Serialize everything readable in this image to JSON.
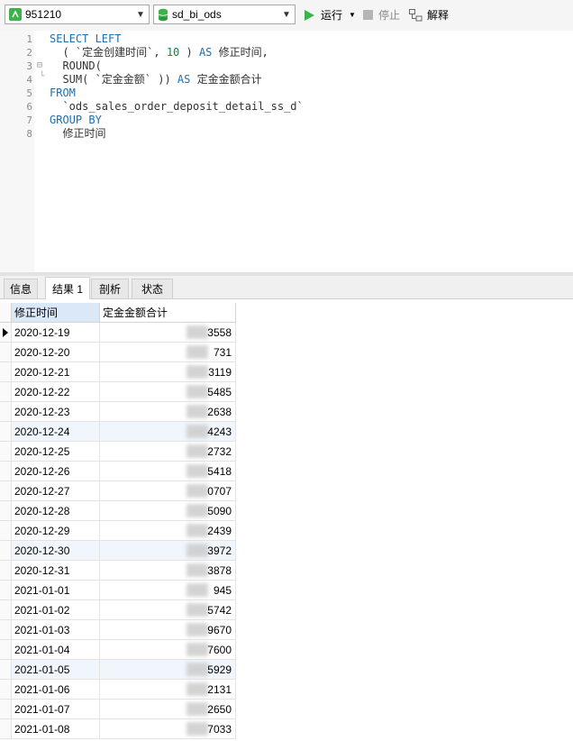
{
  "toolbar": {
    "connection": "951210",
    "database": "sd_bi_ods",
    "run_label": "运行",
    "stop_label": "停止",
    "explain_label": "解释"
  },
  "editor": {
    "line_numbers": [
      "1",
      "2",
      "3",
      "4",
      "5",
      "6",
      "7",
      "8"
    ],
    "lines": [
      {
        "parts": [
          {
            "t": "SELECT LEFT",
            "k": "kw"
          }
        ]
      },
      {
        "parts": [
          {
            "t": "  ( `定金创建时间`, ",
            "k": ""
          },
          {
            "t": "10",
            "k": "num"
          },
          {
            "t": " ) ",
            "k": ""
          },
          {
            "t": "AS",
            "k": "kw"
          },
          {
            "t": " 修正时间,",
            "k": ""
          }
        ]
      },
      {
        "parts": [
          {
            "t": "  ROUND(",
            "k": ""
          }
        ]
      },
      {
        "parts": [
          {
            "t": "  SUM( `定金金额` )) ",
            "k": ""
          },
          {
            "t": "AS",
            "k": "kw"
          },
          {
            "t": " 定金金额合计",
            "k": ""
          }
        ]
      },
      {
        "parts": [
          {
            "t": "FROM",
            "k": "kw"
          }
        ]
      },
      {
        "parts": [
          {
            "t": "  `ods_sales_order_deposit_detail_ss_d`",
            "k": ""
          }
        ]
      },
      {
        "parts": [
          {
            "t": "GROUP BY",
            "k": "kw"
          }
        ]
      },
      {
        "parts": [
          {
            "t": "  修正时间",
            "k": ""
          }
        ]
      }
    ]
  },
  "tabs": [
    {
      "label": "信息",
      "active": false
    },
    {
      "label": "结果 1",
      "active": true
    },
    {
      "label": "剖析",
      "active": false
    },
    {
      "label": "状态",
      "active": false
    }
  ],
  "grid": {
    "columns": [
      "修正时间",
      "定金金额合计"
    ],
    "rows": [
      {
        "date": "2020-12-19",
        "amount": "3558"
      },
      {
        "date": "2020-12-20",
        "amount": "731"
      },
      {
        "date": "2020-12-21",
        "amount": "3119"
      },
      {
        "date": "2020-12-22",
        "amount": "5485"
      },
      {
        "date": "2020-12-23",
        "amount": "2638"
      },
      {
        "date": "2020-12-24",
        "amount": "4243"
      },
      {
        "date": "2020-12-25",
        "amount": "2732"
      },
      {
        "date": "2020-12-26",
        "amount": "5418"
      },
      {
        "date": "2020-12-27",
        "amount": "0707"
      },
      {
        "date": "2020-12-28",
        "amount": "5090"
      },
      {
        "date": "2020-12-29",
        "amount": "2439"
      },
      {
        "date": "2020-12-30",
        "amount": "3972"
      },
      {
        "date": "2020-12-31",
        "amount": "3878"
      },
      {
        "date": "2021-01-01",
        "amount": "945"
      },
      {
        "date": "2021-01-02",
        "amount": "5742"
      },
      {
        "date": "2021-01-03",
        "amount": "9670"
      },
      {
        "date": "2021-01-04",
        "amount": "7600"
      },
      {
        "date": "2021-01-05",
        "amount": "5929"
      },
      {
        "date": "2021-01-06",
        "amount": "2131"
      },
      {
        "date": "2021-01-07",
        "amount": "2650"
      },
      {
        "date": "2021-01-08",
        "amount": "7033"
      }
    ]
  },
  "colors": {
    "keyword": "#1a6fb5",
    "number": "#0a8a3c",
    "header_selected": "#dbe8f7",
    "row_highlight": "#f0f6fc"
  }
}
